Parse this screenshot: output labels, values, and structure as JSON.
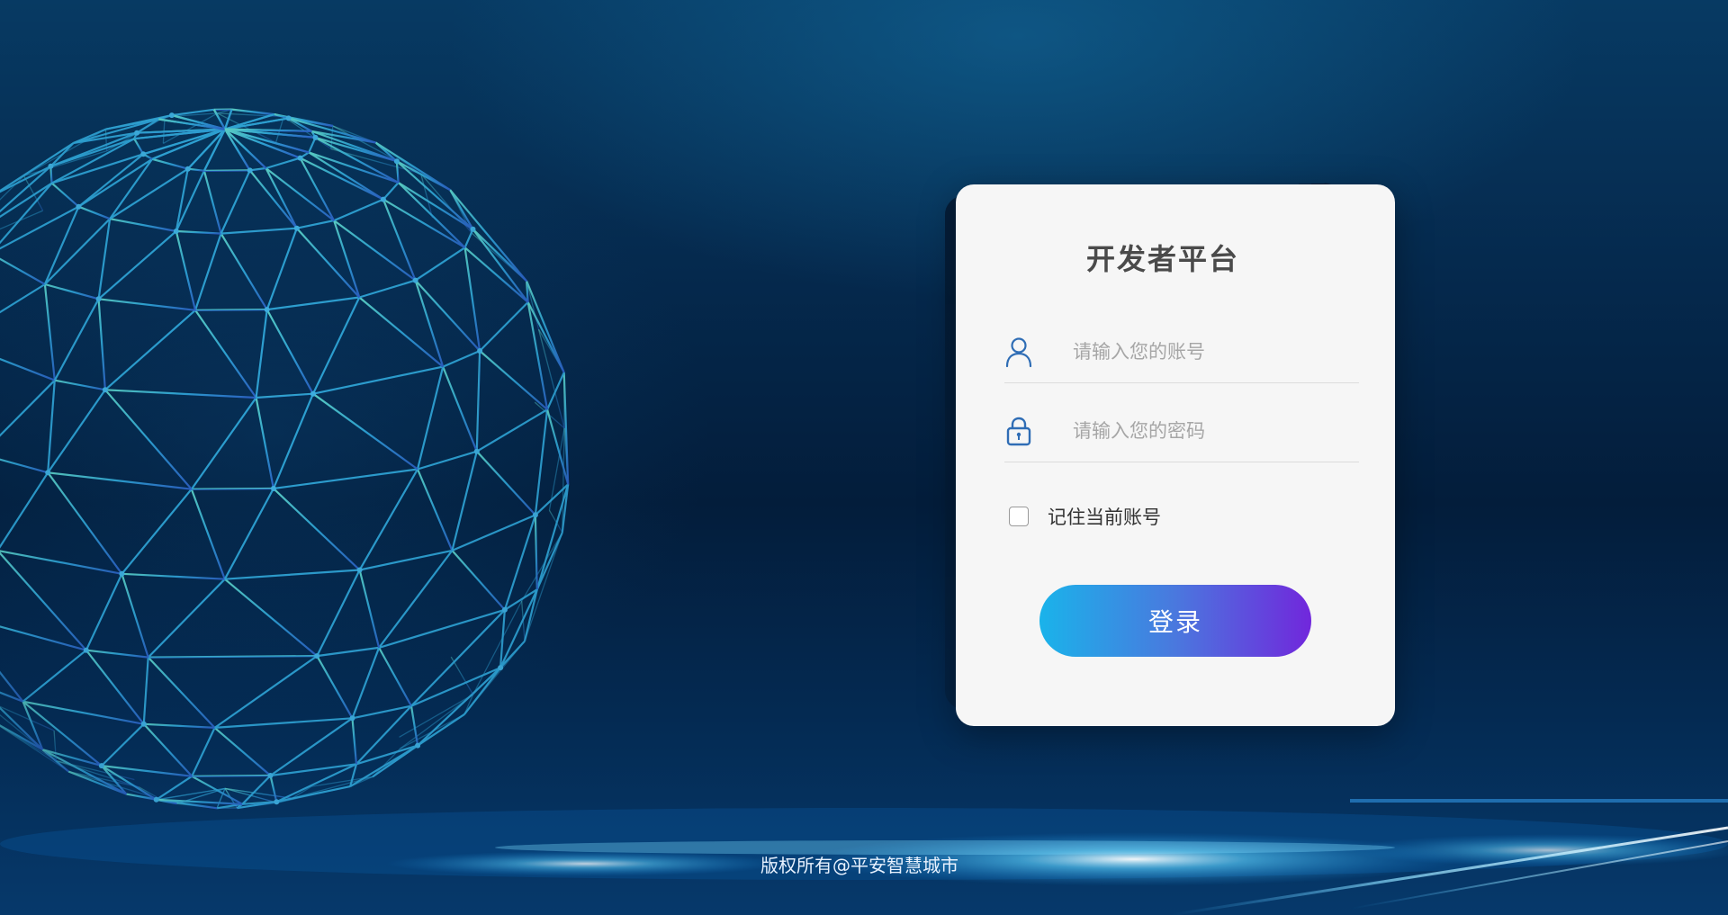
{
  "login_card": {
    "title": "开发者平台",
    "username_placeholder": "请输入您的账号",
    "password_placeholder": "请输入您的密码",
    "remember_label": "记住当前账号",
    "remember_checked": false,
    "login_button": "登录",
    "icon_color": "#2f6db5"
  },
  "footer": {
    "copyright": "版权所有@平安智慧城市"
  },
  "colors": {
    "background": "#031d3b",
    "card": "#f6f6f6",
    "button_gradient_start": "#1ab3ea",
    "button_gradient_end": "#7127dc",
    "globe_lines": "#2fb6d6"
  },
  "icons": {
    "username": "user-icon",
    "password": "lock-icon"
  }
}
